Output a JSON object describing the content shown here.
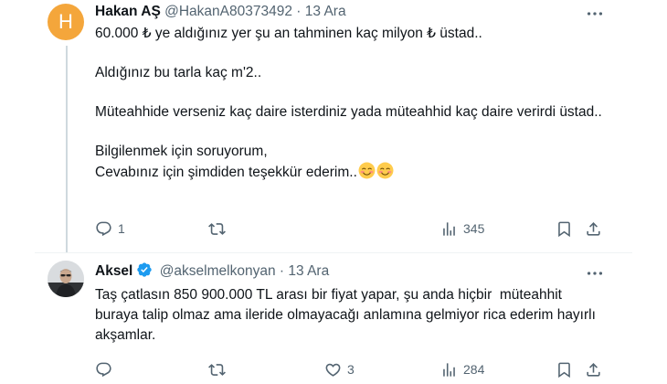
{
  "tweet1": {
    "avatar_letter": "H",
    "name": "Hakan AŞ",
    "handle": "@HakanA80373492",
    "separator": "·",
    "date": "13 Ara",
    "paragraphs": [
      "60.000 ₺ ye aldığınız yer şu an tahminen kaç milyon ₺ üstad..",
      "Aldığınız bu tarla kaç m'2..",
      "Müteahhide verseniz kaç daire isterdiniz yada müteahhid kaç daire verirdi üstad..",
      "Bilgilenmek için soruyorum,\nCevabınız için şimdiden teşekkür ederim.."
    ],
    "emoji": "smiling-face-emoji",
    "actions": {
      "reply_count": "1",
      "retweet_count": "",
      "like_count": "",
      "views_count": "345"
    }
  },
  "tweet2": {
    "name": "Aksel",
    "handle": "@akselmelkonyan",
    "separator": "·",
    "date": "13 Ara",
    "verified_color": "#1d9bf0",
    "text": "Taş çatlasın 850 900.000 TL arası bir fiyat yapar, şu anda hiçbir  müteahhit buraya talip olmaz ama ileride olmayacağı anlamına gelmiyor rica ederim hayırlı akşamlar.",
    "actions": {
      "reply_count": "",
      "retweet_count": "",
      "like_count": "3",
      "views_count": "284"
    }
  }
}
